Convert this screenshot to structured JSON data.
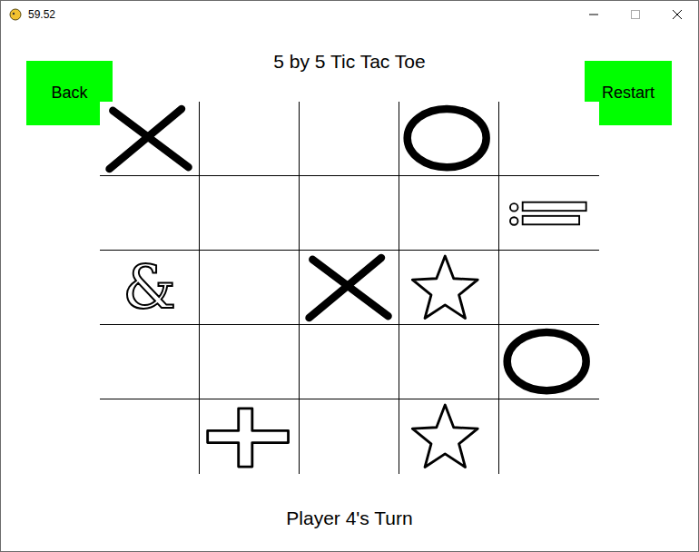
{
  "window": {
    "title": "59.52"
  },
  "header": {
    "title": "5 by 5 Tic Tac Toe"
  },
  "buttons": {
    "back": "Back",
    "restart": "Restart"
  },
  "board": [
    [
      {
        "kind": "x"
      },
      {
        "kind": "empty"
      },
      {
        "kind": "empty"
      },
      {
        "kind": "o"
      },
      {
        "kind": "empty"
      }
    ],
    [
      {
        "kind": "empty"
      },
      {
        "kind": "empty"
      },
      {
        "kind": "empty"
      },
      {
        "kind": "empty"
      },
      {
        "kind": "dots-bars"
      }
    ],
    [
      {
        "kind": "glyph",
        "text": "&"
      },
      {
        "kind": "empty"
      },
      {
        "kind": "x"
      },
      {
        "kind": "star"
      },
      {
        "kind": "empty"
      }
    ],
    [
      {
        "kind": "empty"
      },
      {
        "kind": "empty"
      },
      {
        "kind": "empty"
      },
      {
        "kind": "empty"
      },
      {
        "kind": "o"
      }
    ],
    [
      {
        "kind": "empty"
      },
      {
        "kind": "plus"
      },
      {
        "kind": "empty"
      },
      {
        "kind": "star"
      },
      {
        "kind": "empty"
      }
    ]
  ],
  "status": "Player 4's Turn"
}
